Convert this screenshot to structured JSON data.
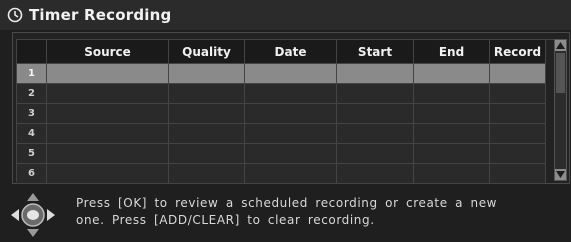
{
  "window": {
    "title": "Timer Recording",
    "icon": "clock-icon"
  },
  "table": {
    "columns": [
      "",
      "Source",
      "Quality",
      "Date",
      "Start",
      "End",
      "Record"
    ],
    "rows": [
      {
        "number": "1",
        "source": "",
        "quality": "",
        "date": "",
        "start": "",
        "end": "",
        "record": "",
        "selected": true
      },
      {
        "number": "2",
        "source": "",
        "quality": "",
        "date": "",
        "start": "",
        "end": "",
        "record": "",
        "selected": false
      },
      {
        "number": "3",
        "source": "",
        "quality": "",
        "date": "",
        "start": "",
        "end": "",
        "record": "",
        "selected": false
      },
      {
        "number": "4",
        "source": "",
        "quality": "",
        "date": "",
        "start": "",
        "end": "",
        "record": "",
        "selected": false
      },
      {
        "number": "5",
        "source": "",
        "quality": "",
        "date": "",
        "start": "",
        "end": "",
        "record": "",
        "selected": false
      },
      {
        "number": "6",
        "source": "",
        "quality": "",
        "date": "",
        "start": "",
        "end": "",
        "record": "",
        "selected": false
      }
    ]
  },
  "footer": {
    "nav_icon": "dpad-ok-icon",
    "help_text": "Press [OK] to review a scheduled recording or create a new\none. Press [ADD/CLEAR] to clear recording."
  },
  "colors": {
    "selected_row": "#8a8a8a",
    "background": "#1f1f1f"
  }
}
